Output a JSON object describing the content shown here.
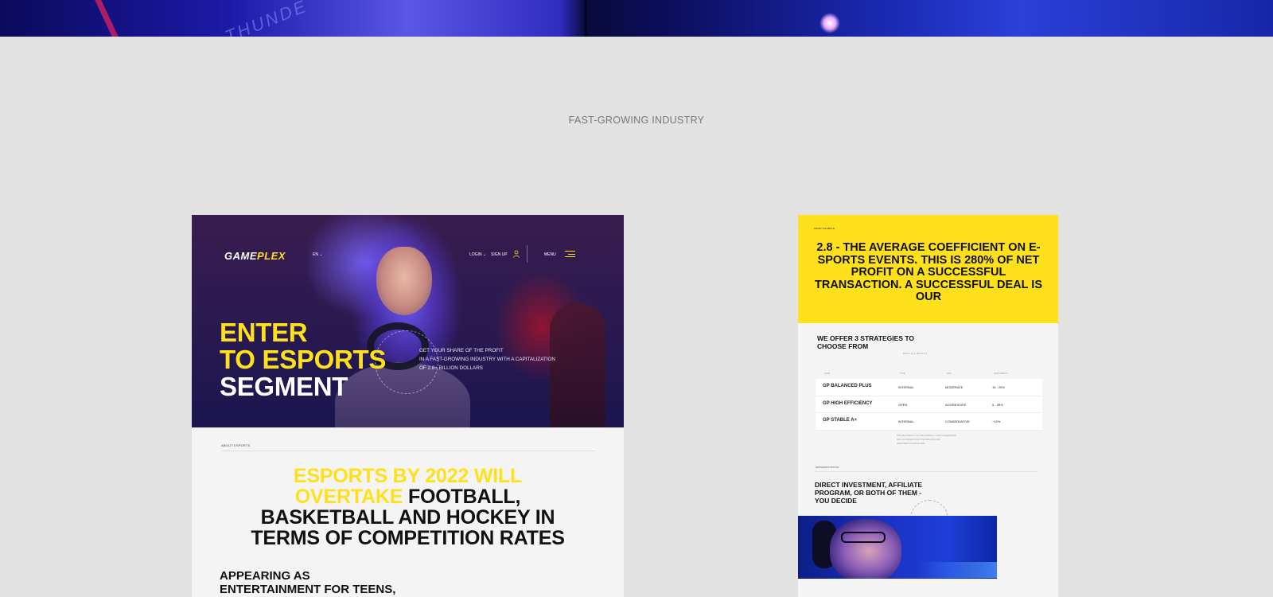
{
  "section_title": "FAST-GROWING INDUSTRY",
  "top_strip": {
    "text": "THUNDE"
  },
  "left_mockup": {
    "logo_part1": "GAME",
    "logo_part2": "PLEX",
    "lang": "EN",
    "login": "LOGIN",
    "signup": "SIGN UP",
    "menu": "MENU",
    "hero_line1": "ENTER",
    "hero_line2": "TO ESPORTS",
    "hero_line3": "SEGMENT",
    "hero_sub_1": "GET YOUR SHARE OF THE PROFIT",
    "hero_sub_2": "IN A FAST-GROWING INDUSTRY WITH A CAPITALIZATION",
    "hero_sub_3": "OF 2.8+ BILLION DOLLARS",
    "about_label": "ABOUT ESPORTS",
    "headline_yellow_1": "ESPORTS BY 2022 WILL",
    "headline_yellow_2": "OVERTAKE",
    "headline_black_1": "FOOTBALL,",
    "headline_black_2": "BASKETBALL AND HOCKEY IN",
    "headline_black_3": "TERMS OF COMPETITION RATES",
    "appearing_1": "APPEARING AS",
    "appearing_2": "ENTERTAINMENT FOR TEENS,"
  },
  "right_mockup": {
    "yellow_label": "PROFIT EXAMPLE",
    "yellow_text": "2.8 - THE AVERAGE COEFFICIENT ON E-SPORTS EVENTS. THIS IS 280% OF NET PROFIT ON A SUCCESSFUL TRANSACTION. A SUCCESSFUL DEAL IS OUR",
    "offer_1": "WE OFFER 3 STRATEGIES TO",
    "offer_2": "CHOOSE FROM",
    "offer_small": "READ ALL DETAILS",
    "table_headers": [
      "NAME",
      "TYPE",
      "RISK",
      "PROFITABILITY"
    ],
    "strategies": [
      {
        "name": "GP BALANCED PLUS",
        "type": "INTERNAL",
        "risk": "MODERATE",
        "profit": "15 - 25%"
      },
      {
        "name": "GP HIGH EFFICIENCY",
        "type": "OPEN",
        "risk": "AGGRESSIVE",
        "profit": "5 - 35%"
      },
      {
        "name": "GP STABLE A+",
        "type": "INTERNAL",
        "risk": "CONSERVATIVE",
        "profit": "~10%"
      }
    ],
    "note_1": "THE PROFITABILITY OF THE STRATEGY IS NOT GUARANTEED",
    "note_2": "AND CAN DIFFER FROM THE INDICATED ONE",
    "note_3": "INVESTMENTS INVOLVE RISK",
    "sub_label": "PARTNERSHIP OPTIONS",
    "direct_1": "DIRECT INVESTMENT, AFFILIATE",
    "direct_2": "PROGRAM, OR BOTH OF THEM -",
    "direct_3": "YOU DECIDE"
  }
}
